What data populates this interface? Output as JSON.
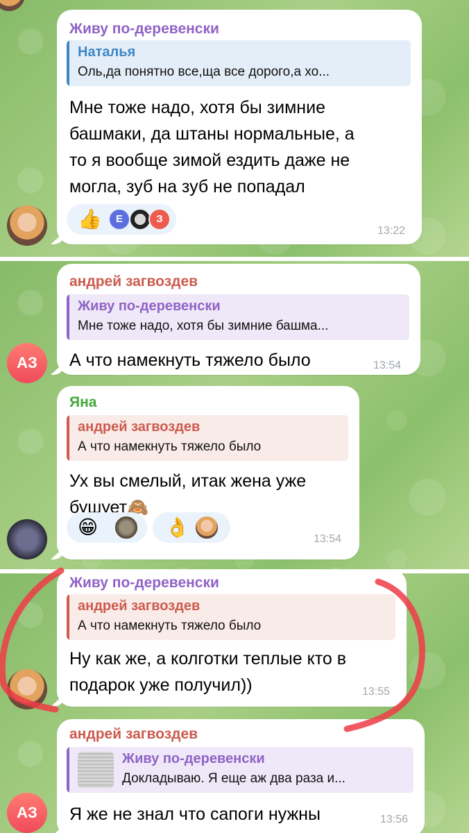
{
  "colors": {
    "sender_zhivu": "#8f63c6",
    "sender_andrey": "#cc5b4d",
    "sender_yana": "#45a83a",
    "sender_natalya": "#3d86c6",
    "annotation_red": "#ee3c47"
  },
  "messages": [
    {
      "sender": "Живу по-деревенски",
      "reply_name": "Наталья",
      "reply_text": "Оль,да понятно все,ща все дорого,а хо...",
      "text_lines": [
        "Мне тоже надо, хотя бы зимние",
        "башмаки, да штаны нормальные, а",
        "то я вообще зимой ездить даже не",
        "могла, зуб на зуб не попадал"
      ],
      "time": "13:22",
      "reactions": [
        {
          "emoji": "👍",
          "avatars": [
            "Е",
            "",
            "З"
          ]
        }
      ]
    },
    {
      "sender": "андрей загвоздев",
      "reply_name": "Живу по-деревенски",
      "reply_text": "Мне тоже надо, хотя бы зимние башма...",
      "text_lines": [
        "А что намекнуть тяжело было"
      ],
      "time": "13:54",
      "avatar_initials": "АЗ"
    },
    {
      "sender": "Яна",
      "reply_name": "андрей загвоздев",
      "reply_text": "А что намекнуть тяжело было",
      "text_lines": [
        "Ух вы смелый, итак жена уже",
        "бушует🙈"
      ],
      "time": "13:54",
      "reactions": [
        {
          "emoji": "😁"
        },
        {
          "emoji": "👌"
        }
      ]
    },
    {
      "sender": "Живу по-деревенски",
      "reply_name": "андрей загвоздев",
      "reply_text": "А что намекнуть тяжело было",
      "text_lines": [
        "Ну как же, а колготки теплые кто в",
        "подарок уже получил))"
      ],
      "time": "13:55"
    },
    {
      "sender": "андрей загвоздев",
      "reply_name": "Живу по-деревенски",
      "reply_text": "Докладываю. Я еще аж два раза и...",
      "text_lines": [
        "Я же не знал что сапоги нужны"
      ],
      "time": "13:56",
      "avatar_initials": "АЗ"
    }
  ]
}
